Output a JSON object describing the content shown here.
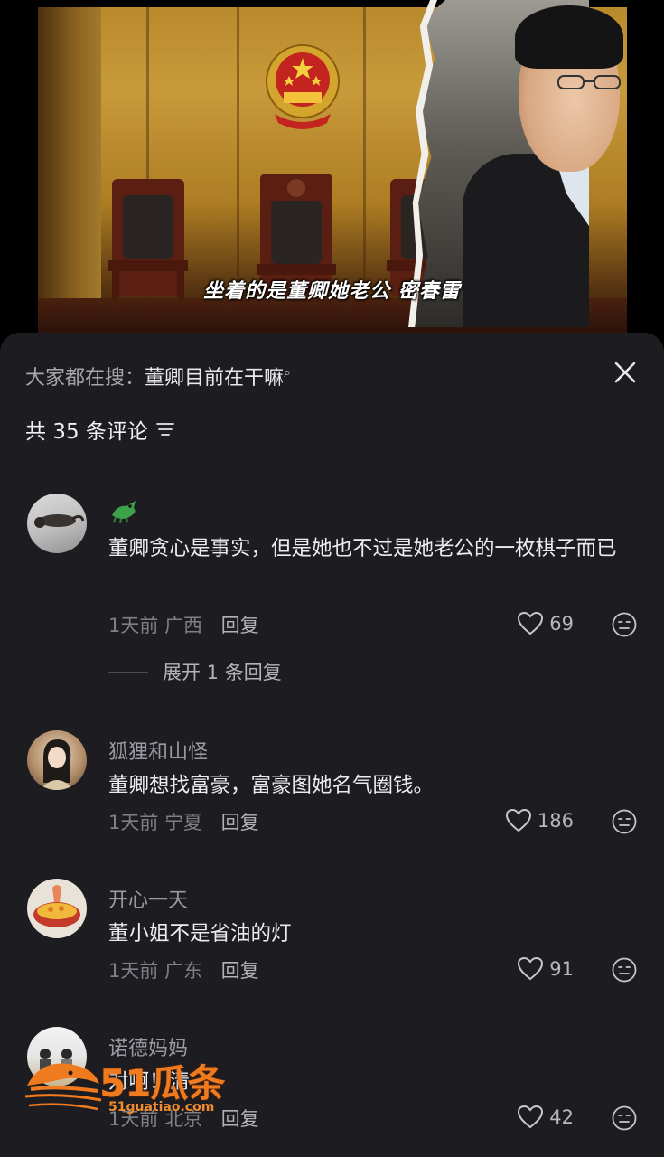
{
  "video": {
    "subtitle": "坐着的是董卿她老公 密春雷"
  },
  "sheet": {
    "search_prefix": "大家都在搜：",
    "search_keyword": "董卿目前在干嘛",
    "comment_count_label": "共 35 条评论"
  },
  "comments": [
    {
      "name": "",
      "text": "董卿贪心是事实，但是她也不过是她老公的一枚棋子而已",
      "time": "1天前",
      "location": "广西",
      "reply_label": "回复",
      "likes": "69",
      "expand_label": "展开 1 条回复"
    },
    {
      "name": "狐狸和山怪",
      "text": "董卿想找富豪，富豪图她名气圈钱。",
      "time": "1天前",
      "location": "宁夏",
      "reply_label": "回复",
      "likes": "186"
    },
    {
      "name": "开心一天",
      "text": "董小姐不是省油的灯",
      "time": "1天前",
      "location": "广东",
      "reply_label": "回复",
      "likes": "91"
    },
    {
      "name": "诺德妈妈",
      "text": "对啊！清",
      "time": "1天前",
      "location": "北京",
      "reply_label": "回复",
      "likes": "42"
    }
  ],
  "watermark": {
    "brand": "51瓜条",
    "url": "51guatiao.com"
  },
  "colors": {
    "sheet_bg": "#1c1c21",
    "primary_text": "#ededf0",
    "secondary_text": "#9a9aa2",
    "watermark_orange": "#f07a1e"
  }
}
